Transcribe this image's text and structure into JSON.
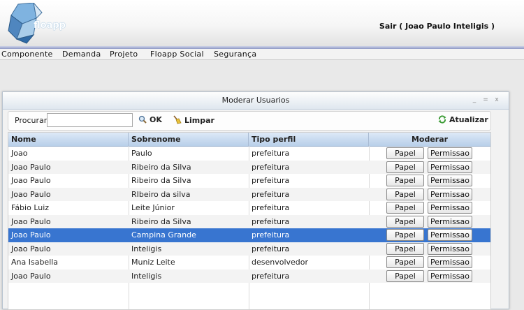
{
  "header": {
    "logo_text": "floapp",
    "user_link": "Sair ( Joao Paulo Inteligis )"
  },
  "menu": [
    "Componente",
    "Demanda",
    "Projeto",
    "Floapp Social",
    "Segurança"
  ],
  "window": {
    "title": "Moderar Usuarios",
    "controls": [
      "_",
      "=",
      "x"
    ]
  },
  "toolbar": {
    "search_label": "Procurar",
    "search_value": "",
    "ok_label": "OK",
    "clear_label": "Limpar",
    "refresh_label": "Atualizar"
  },
  "table": {
    "columns": [
      "Nome",
      "Sobrenome",
      "Tipo perfil",
      "Moderar"
    ],
    "role_button": "Papel",
    "permission_button": "Permissao",
    "selected_index": 6,
    "rows": [
      [
        "Joao",
        "Paulo",
        "prefeitura"
      ],
      [
        "Joao Paulo",
        "Ribeiro da Silva",
        "prefeitura"
      ],
      [
        "Joao Paulo",
        "Ribeiro da Silva",
        "prefeitura"
      ],
      [
        "Joao Paulo",
        "RIbeiro da silva",
        "prefeitura"
      ],
      [
        "Fábio Luiz",
        "Leite Júnior",
        "prefeitura"
      ],
      [
        "Joao Paulo",
        "Ribeiro da Silva",
        "prefeitura"
      ],
      [
        "Joao Paulo",
        "Campina Grande",
        "prefeitura"
      ],
      [
        "Joao Paulo",
        "Inteligis",
        "prefeitura"
      ],
      [
        "Ana Isabella",
        "Muniz Leite",
        "desenvolvedor"
      ],
      [
        "Joao Paulo",
        "Inteligis",
        "prefeitura"
      ]
    ]
  },
  "colors": {
    "selection": "#3875d0",
    "header_blue": "#b8cfe9"
  }
}
